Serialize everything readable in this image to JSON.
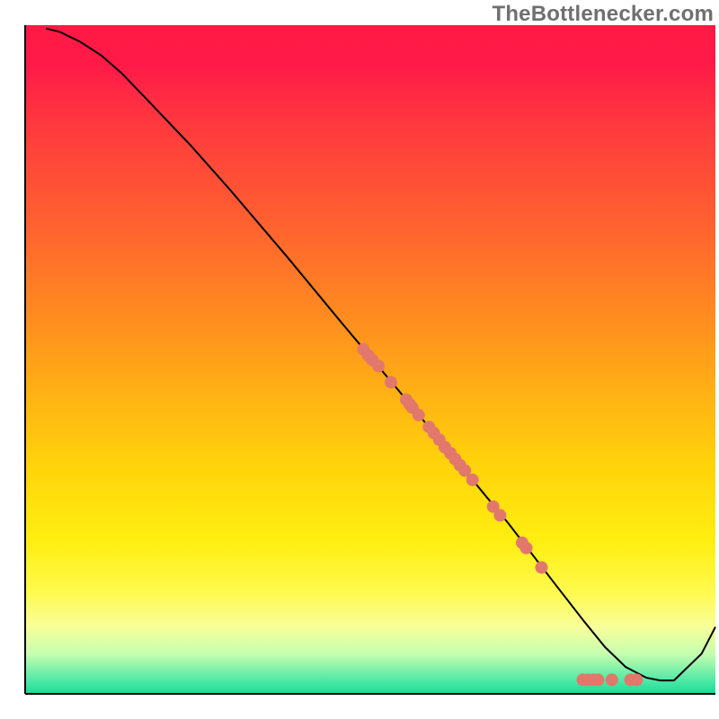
{
  "watermark": "TheBottlenecker.com",
  "chart_data": {
    "type": "line",
    "title": "",
    "xlabel": "",
    "ylabel": "",
    "xlim": [
      0,
      100
    ],
    "ylim": [
      0,
      100
    ],
    "background": {
      "type": "vertical-gradient",
      "stops": [
        {
          "color": "#ff1a45",
          "offset": 0.0
        },
        {
          "color": "#ff1a48",
          "offset": 0.06
        },
        {
          "color": "#ff3a3e",
          "offset": 0.15
        },
        {
          "color": "#ff5f30",
          "offset": 0.29
        },
        {
          "color": "#ff8a20",
          "offset": 0.43
        },
        {
          "color": "#ffb114",
          "offset": 0.55
        },
        {
          "color": "#ffd40a",
          "offset": 0.66
        },
        {
          "color": "#ffee10",
          "offset": 0.77
        },
        {
          "color": "#fffa50",
          "offset": 0.85
        },
        {
          "color": "#f7ff9a",
          "offset": 0.9
        },
        {
          "color": "#c6ffb0",
          "offset": 0.94
        },
        {
          "color": "#4fe8a5",
          "offset": 0.98
        },
        {
          "color": "#17dd98",
          "offset": 1.0
        }
      ]
    },
    "series": [
      {
        "name": "bottleneck-curve",
        "x": [
          3.0,
          5.0,
          8.0,
          11.0,
          14.0,
          18.0,
          24.0,
          30.0,
          38.0,
          46.0,
          54.0,
          62.0,
          70.0,
          77.0,
          81.0,
          84.0,
          87.0,
          90.0,
          92.0,
          94.0,
          98.0,
          100.0
        ],
        "y": [
          99.5,
          99.0,
          97.5,
          95.5,
          92.8,
          88.5,
          82.0,
          75.0,
          65.3,
          55.3,
          45.5,
          35.5,
          25.5,
          16.1,
          10.8,
          7.0,
          4.0,
          2.4,
          2.0,
          2.0,
          6.0,
          10.0
        ]
      }
    ],
    "scatter": [
      {
        "name": "points-on-curve",
        "points": [
          {
            "x": 49.0,
            "y": 51.5
          },
          {
            "x": 49.7,
            "y": 50.6
          },
          {
            "x": 50.3,
            "y": 49.9
          },
          {
            "x": 51.2,
            "y": 49.0
          },
          {
            "x": 53.0,
            "y": 46.6
          },
          {
            "x": 55.2,
            "y": 44.0
          },
          {
            "x": 55.7,
            "y": 43.3
          },
          {
            "x": 56.1,
            "y": 42.8
          },
          {
            "x": 57.0,
            "y": 41.7
          },
          {
            "x": 58.5,
            "y": 39.9
          },
          {
            "x": 59.2,
            "y": 39.0
          },
          {
            "x": 60.0,
            "y": 38.0
          },
          {
            "x": 60.8,
            "y": 36.9
          },
          {
            "x": 61.6,
            "y": 36.0
          },
          {
            "x": 62.3,
            "y": 35.1
          },
          {
            "x": 63.0,
            "y": 34.2
          },
          {
            "x": 63.7,
            "y": 33.4
          },
          {
            "x": 64.8,
            "y": 32.0
          },
          {
            "x": 67.8,
            "y": 28.0
          },
          {
            "x": 68.8,
            "y": 26.7
          },
          {
            "x": 72.0,
            "y": 22.6
          },
          {
            "x": 72.6,
            "y": 21.8
          },
          {
            "x": 74.8,
            "y": 18.9
          },
          {
            "x": 80.8,
            "y": 2.1
          },
          {
            "x": 81.5,
            "y": 2.1
          },
          {
            "x": 82.3,
            "y": 2.1
          },
          {
            "x": 83.0,
            "y": 2.1
          },
          {
            "x": 85.0,
            "y": 2.1
          },
          {
            "x": 87.7,
            "y": 2.1
          },
          {
            "x": 88.6,
            "y": 2.1
          }
        ]
      }
    ],
    "axes": {
      "left": {
        "visible": true,
        "color": "#000000",
        "width": 2
      },
      "bottom": {
        "visible": true,
        "color": "#000000",
        "width": 2
      }
    },
    "point_style": {
      "fill": "#e2786b",
      "radius": 7
    }
  }
}
